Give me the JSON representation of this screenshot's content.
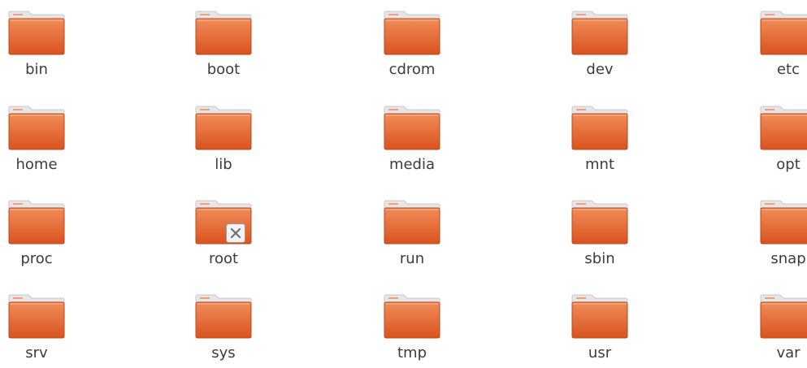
{
  "folders": [
    {
      "name": "bin"
    },
    {
      "name": "boot"
    },
    {
      "name": "cdrom"
    },
    {
      "name": "dev"
    },
    {
      "name": "etc"
    },
    {
      "name": "home"
    },
    {
      "name": "lib"
    },
    {
      "name": "media"
    },
    {
      "name": "mnt"
    },
    {
      "name": "opt"
    },
    {
      "name": "proc"
    },
    {
      "name": "root",
      "emblem": "unreadable-emblem-icon"
    },
    {
      "name": "run"
    },
    {
      "name": "sbin"
    },
    {
      "name": "snap"
    },
    {
      "name": "srv"
    },
    {
      "name": "sys"
    },
    {
      "name": "tmp"
    },
    {
      "name": "usr"
    },
    {
      "name": "var"
    }
  ],
  "icons": {
    "folder": "folder-icon",
    "emblem": "unreadable-emblem-icon"
  },
  "colors": {
    "folder_top": "#f08c5a",
    "folder_bottom": "#d9531e",
    "folder_tab": "#e6e6e6",
    "label_text": "#3c3c3c"
  }
}
